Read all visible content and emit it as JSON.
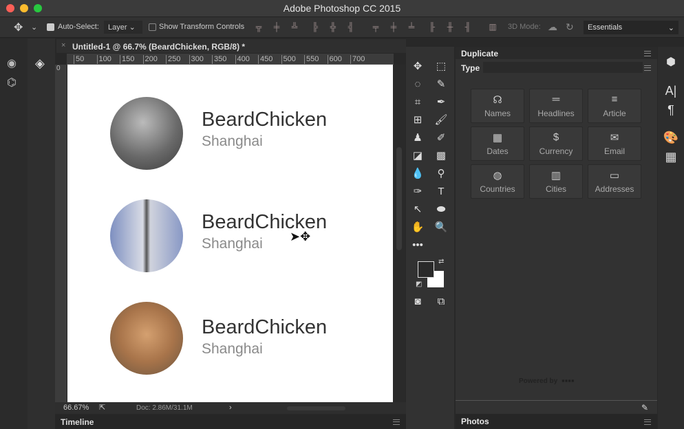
{
  "window": {
    "title": "Adobe Photoshop CC 2015"
  },
  "options_bar": {
    "auto_select_label": "Auto-Select:",
    "auto_select_checked": true,
    "layer_select": "Layer",
    "show_transform_label": "Show Transform Controls",
    "show_transform_checked": false,
    "mode_3d_label": "3D Mode:",
    "workspace": "Essentials"
  },
  "document": {
    "tab_title": "Untitled-1 @ 66.7% (BeardChicken, RGB/8) *",
    "close": "×",
    "ruler_top": [
      "50",
      "100",
      "150",
      "200",
      "250",
      "300",
      "350",
      "400",
      "450",
      "500",
      "550",
      "600",
      "700"
    ],
    "ruler_left_start": "0",
    "cards": [
      {
        "name": "BeardChicken",
        "city": "Shanghai"
      },
      {
        "name": "BeardChicken",
        "city": "Shanghai"
      },
      {
        "name": "BeardChicken",
        "city": "Shanghai"
      }
    ]
  },
  "status": {
    "zoom": "66.67%",
    "doc": "Doc: 2.86M/31.1M",
    "arrow": "›"
  },
  "timeline": {
    "title": "Timeline"
  },
  "panel": {
    "title": "Duplicate",
    "subtitle": "Type",
    "footer": "Powered by",
    "buttons": [
      {
        "label": "Names",
        "icon": "people-icon",
        "glyph": "☊"
      },
      {
        "label": "Headlines",
        "icon": "headline-icon",
        "glyph": "═"
      },
      {
        "label": "Article",
        "icon": "article-icon",
        "glyph": "≡"
      },
      {
        "label": "Dates",
        "icon": "calendar-icon",
        "glyph": "▦"
      },
      {
        "label": "Currency",
        "icon": "dollar-icon",
        "glyph": "$"
      },
      {
        "label": "Email",
        "icon": "envelope-icon",
        "glyph": "✉"
      },
      {
        "label": "Countries",
        "icon": "globe-icon",
        "glyph": "◍"
      },
      {
        "label": "Cities",
        "icon": "building-icon",
        "glyph": "▥"
      },
      {
        "label": "Addresses",
        "icon": "address-card-icon",
        "glyph": "▭"
      }
    ]
  },
  "photos": {
    "title": "Photos"
  }
}
